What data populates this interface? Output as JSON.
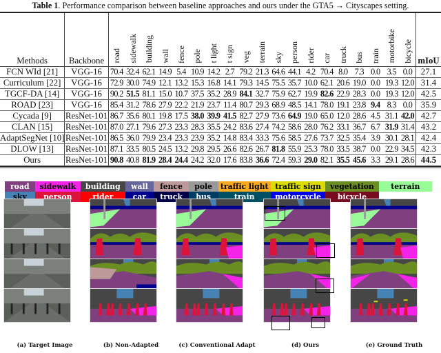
{
  "caption": {
    "label": "Table 1",
    "text": ". Performance comparison between baseline approaches and ours under the GTA5 → Cityscapes setting."
  },
  "table": {
    "method_header": "Methods",
    "backbone_header": "Backbone",
    "class_headers": [
      "road",
      "sidewalk",
      "building",
      "wall",
      "fence",
      "pole",
      "t light",
      "t sign",
      "veg",
      "terrain",
      "sky",
      "person",
      "rider",
      "car",
      "truck",
      "bus",
      "train",
      "motorbike",
      "bicycle"
    ],
    "miou_header": "mIoU",
    "rows": [
      {
        "method": "FCN WId [21]",
        "backbone": "VGG-16",
        "values": [
          "70.4",
          "32.4",
          "62.1",
          "14.9",
          "5.4",
          "10.9",
          "14.2",
          "2.7",
          "79.2",
          "21.3",
          "64.6",
          "44.1",
          "4.2",
          "70.4",
          "8.0",
          "7.3",
          "0.0",
          "3.5",
          "0.0"
        ],
        "bold": [],
        "miou": "27.1",
        "miou_bold": false
      },
      {
        "method": "Curriculum [22]",
        "backbone": "VGG-16",
        "values": [
          "72.9",
          "30.0",
          "74.9",
          "12.1",
          "13.2",
          "15.3",
          "16.8",
          "14.1",
          "79.3",
          "14.5",
          "75.5",
          "35.7",
          "10.0",
          "62.1",
          "20.6",
          "19.0",
          "0.0",
          "19.3",
          "12.0"
        ],
        "bold": [],
        "miou": "31.4",
        "miou_bold": false
      },
      {
        "method": "TGCF-DA [14]",
        "backbone": "VGG-16",
        "values": [
          "90.2",
          "51.5",
          "81.1",
          "15.0",
          "10.7",
          "37.5",
          "35.2",
          "28.9",
          "84.1",
          "32.7",
          "75.9",
          "62.7",
          "19.9",
          "82.6",
          "22.9",
          "28.3",
          "0.0",
          "19.3",
          "12.0"
        ],
        "bold": [
          1,
          8,
          13
        ],
        "miou": "42.5",
        "miou_bold": false
      },
      {
        "method": "ROAD [23]",
        "backbone": "VGG-16",
        "values": [
          "85.4",
          "31.2",
          "78.6",
          "27.9",
          "22.2",
          "21.9",
          "23.7",
          "11.4",
          "80.7",
          "29.3",
          "68.9",
          "48.5",
          "14.1",
          "78.0",
          "19.1",
          "23.8",
          "9.4",
          "8.3",
          "0.0"
        ],
        "bold": [
          16
        ],
        "miou": "35.9",
        "miou_bold": false
      },
      {
        "method": "Cycada [9]",
        "backbone": "ResNet-101",
        "values": [
          "86.7",
          "35.6",
          "80.1",
          "19.8",
          "17.5",
          "38.0",
          "39.9",
          "41.5",
          "82.7",
          "27.9",
          "73.6",
          "64.9",
          "19.0",
          "65.0",
          "12.0",
          "28.6",
          "4.5",
          "31.1",
          "42.0"
        ],
        "bold": [
          5,
          6,
          7,
          11,
          18
        ],
        "miou": "42.7",
        "miou_bold": false
      },
      {
        "method": "CLAN [15]",
        "backbone": "ResNet-101",
        "values": [
          "87.0",
          "27.1",
          "79.6",
          "27.3",
          "23.3",
          "28.3",
          "35.5",
          "24.2",
          "83.6",
          "27.4",
          "74.2",
          "58.6",
          "28.0",
          "76.2",
          "33.1",
          "36.7",
          "6.7",
          "31.9",
          "31.4"
        ],
        "bold": [
          17
        ],
        "miou": "43.2",
        "miou_bold": false
      },
      {
        "method": "AdaptSegNet [10]",
        "backbone": "ResNet-101",
        "values": [
          "86.5",
          "36.0",
          "79.9",
          "23.4",
          "23.3",
          "23.9",
          "35.2",
          "14.8",
          "83.4",
          "33.3",
          "75.6",
          "58.5",
          "27.6",
          "73.7",
          "32.5",
          "35.4",
          "3.9",
          "30.1",
          "28.1"
        ],
        "bold": [],
        "miou": "42.4",
        "miou_bold": false
      },
      {
        "method": "DLOW [13]",
        "backbone": "ResNet-101",
        "values": [
          "87.1",
          "33.5",
          "80.5",
          "24.5",
          "13.2",
          "29.8",
          "29.5",
          "26.6",
          "82.6",
          "26.7",
          "81.8",
          "55.9",
          "25.3",
          "78.0",
          "33.5",
          "38.7",
          "0.0",
          "22.9",
          "34.5"
        ],
        "bold": [
          10
        ],
        "miou": "42.3",
        "miou_bold": false
      },
      {
        "method": "Ours",
        "backbone": "ResNet-101",
        "values": [
          "90.8",
          "40.8",
          "81.9",
          "28.4",
          "24.4",
          "24.2",
          "32.0",
          "17.6",
          "83.8",
          "36.6",
          "72.4",
          "59.3",
          "29.0",
          "82.1",
          "35.5",
          "45.6",
          "3.3",
          "29.1",
          "28.6"
        ],
        "bold": [
          0,
          2,
          3,
          4,
          9,
          12,
          14,
          15
        ],
        "miou": "44.5",
        "miou_bold": true
      }
    ]
  },
  "legend": {
    "rows": [
      [
        {
          "label": "road",
          "bg": "#804080",
          "fg": "#ffffff",
          "flex": 44
        },
        {
          "label": "sidewalk",
          "bg": "#f423e8",
          "fg": "#000000",
          "flex": 67
        },
        {
          "label": "building",
          "bg": "#464646",
          "fg": "#ffffff",
          "flex": 65
        },
        {
          "label": "wall",
          "bg": "#66669c",
          "fg": "#ffffff",
          "flex": 42
        },
        {
          "label": "fence",
          "bg": "#be9999",
          "fg": "#000000",
          "flex": 51
        },
        {
          "label": "pole",
          "bg": "#999999",
          "fg": "#000000",
          "flex": 43
        },
        {
          "label": "traffic light",
          "bg": "#faaa1e",
          "fg": "#000000",
          "flex": 77
        },
        {
          "label": "traffic sign",
          "bg": "#dcdc00",
          "fg": "#000000",
          "flex": 80
        },
        {
          "label": "vegetation",
          "bg": "#6b8e23",
          "fg": "#000000",
          "flex": 78
        },
        {
          "label": "terrain",
          "bg": "#98fb98",
          "fg": "#000000",
          "flex": 78
        }
      ],
      [
        {
          "label": "sky",
          "bg": "#4682b4",
          "fg": "#000000",
          "flex": 44
        },
        {
          "label": "person",
          "bg": "#dc143c",
          "fg": "#ffffff",
          "flex": 67
        },
        {
          "label": "rider",
          "bg": "#ff0000",
          "fg": "#ffffff",
          "flex": 65
        },
        {
          "label": "car",
          "bg": "#00008e",
          "fg": "#ffffff",
          "flex": 42
        },
        {
          "label": "truck",
          "bg": "#000046",
          "fg": "#ffffff",
          "flex": 51
        },
        {
          "label": "bus",
          "bg": "#003c64",
          "fg": "#ffffff",
          "flex": 43
        },
        {
          "label": "train",
          "bg": "#005064",
          "fg": "#ffffff",
          "flex": 77
        },
        {
          "label": "motorcycle",
          "bg": "#0000e6",
          "fg": "#ffffff",
          "flex": 80
        },
        {
          "label": "bicycle",
          "bg": "#770b20",
          "fg": "#ffffff",
          "flex": 78
        },
        {
          "label": "",
          "bg": "#ffffff",
          "fg": "#000000",
          "flex": 78
        }
      ]
    ]
  },
  "figure": {
    "column_labels": [
      "(a) Target Image",
      "(b) Non-Adapted",
      "(c) Conventional Adapt",
      "(d) Ours",
      "(e) Ground Truth"
    ],
    "rows": 4
  }
}
